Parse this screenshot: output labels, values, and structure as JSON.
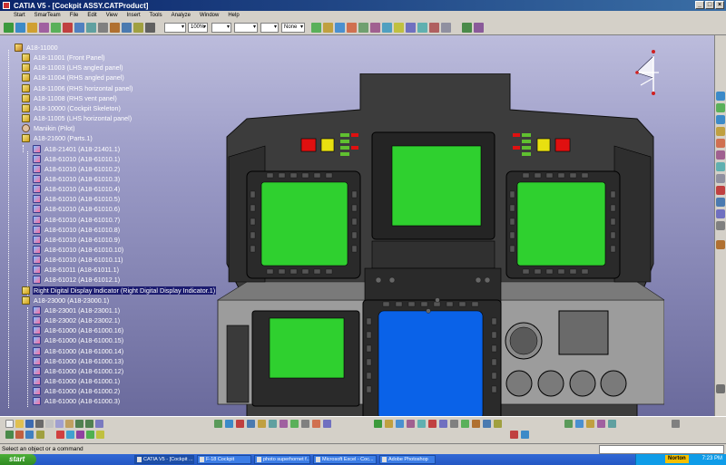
{
  "window": {
    "title": "CATIA V5 - [Cockpit ASSY.CATProduct]"
  },
  "menu": [
    "Start",
    "SmarTeam",
    "File",
    "Edit",
    "View",
    "Insert",
    "Tools",
    "Analyze",
    "Window",
    "Help"
  ],
  "toolbar": {
    "zoom_value": "100%",
    "layer_value": "None"
  },
  "tree": {
    "root": "A18-11000",
    "items": [
      {
        "label": "A18-11001 (Front Panel)",
        "icon": "product-icon"
      },
      {
        "label": "A18-11003 (LHS angled panel)",
        "icon": "product-icon"
      },
      {
        "label": "A18-11004 (RHS angled panel)",
        "icon": "product-icon"
      },
      {
        "label": "A18-11006 (RHS horizontal panel)",
        "icon": "product-icon"
      },
      {
        "label": "A18-11008 (RHS vent panel)",
        "icon": "product-icon"
      },
      {
        "label": "A18-10000 (Cockpit Skeleton)",
        "icon": "product-icon"
      },
      {
        "label": "A18-11005 (LHS horizontal panel)",
        "icon": "product-icon"
      },
      {
        "label": "Manikin (Pilot)",
        "icon": "manikin-icon"
      },
      {
        "label": "A18-21600 (Parts.1)",
        "icon": "product-icon"
      },
      {
        "label": "A18-21401 (A18-21401.1)",
        "icon": "part-icon"
      },
      {
        "label": "A18-61010 (A18-61010.1)",
        "icon": "part-icon"
      },
      {
        "label": "A18-61010 (A18-61010.2)",
        "icon": "part-icon"
      },
      {
        "label": "A18-61010 (A18-61010.3)",
        "icon": "part-icon"
      },
      {
        "label": "A18-61010 (A18-61010.4)",
        "icon": "part-icon"
      },
      {
        "label": "A18-61010 (A18-61010.5)",
        "icon": "part-icon"
      },
      {
        "label": "A18-61010 (A18-61010.6)",
        "icon": "part-icon"
      },
      {
        "label": "A18-61010 (A18-61010.7)",
        "icon": "part-icon"
      },
      {
        "label": "A18-61010 (A18-61010.8)",
        "icon": "part-icon"
      },
      {
        "label": "A18-61010 (A18-61010.9)",
        "icon": "part-icon"
      },
      {
        "label": "A18-61010 (A18-61010.10)",
        "icon": "part-icon"
      },
      {
        "label": "A18-61010 (A18-61010.11)",
        "icon": "part-icon"
      },
      {
        "label": "A18-61011 (A18-61011.1)",
        "icon": "part-icon"
      },
      {
        "label": "A18-61012 (A18-61012.1)",
        "icon": "part-icon"
      },
      {
        "label": "Right Digital Display Indicator (Right Digital Display Indicator.1)",
        "icon": "product-icon",
        "selected": true
      },
      {
        "label": "A18-23000 (A18-23000.1)",
        "icon": "product-icon"
      },
      {
        "label": "A18-23001 (A18-23001.1)",
        "icon": "part-icon"
      },
      {
        "label": "A18-23002 (A18-23002.1)",
        "icon": "part-icon"
      },
      {
        "label": "A18-61000 (A18-61000.16)",
        "icon": "part-icon"
      },
      {
        "label": "A18-61000 (A18-61000.15)",
        "icon": "part-icon"
      },
      {
        "label": "A18-61000 (A18-61000.14)",
        "icon": "part-icon"
      },
      {
        "label": "A18-61000 (A18-61000.13)",
        "icon": "part-icon"
      },
      {
        "label": "A18-61000 (A18-61000.12)",
        "icon": "part-icon"
      },
      {
        "label": "A18-61000 (A18-61000.1)",
        "icon": "part-icon"
      },
      {
        "label": "A18-61000 (A18-61000.2)",
        "icon": "part-icon"
      },
      {
        "label": "A18-61000 (A18-61000.3)",
        "icon": "part-icon"
      }
    ]
  },
  "status": {
    "message": "Select an object or a command"
  },
  "taskbar": {
    "start_label": "start",
    "tasks": [
      "CATIA V5 - [Cockpit ...",
      "F-18 Cockpit",
      "photo superhornet f...",
      "Microsoft Excel - Coc...",
      "Adobe Photoshop"
    ],
    "norton_label": "Norton",
    "clock": "7:23 PM"
  },
  "colors": {
    "display_green": "#2fd02f",
    "display_blue": "#0a62e8",
    "panel_dark": "#3a3a3a",
    "panel_grey": "#9a9a9a",
    "warn_red": "#e01010",
    "warn_yellow": "#e8e010"
  }
}
